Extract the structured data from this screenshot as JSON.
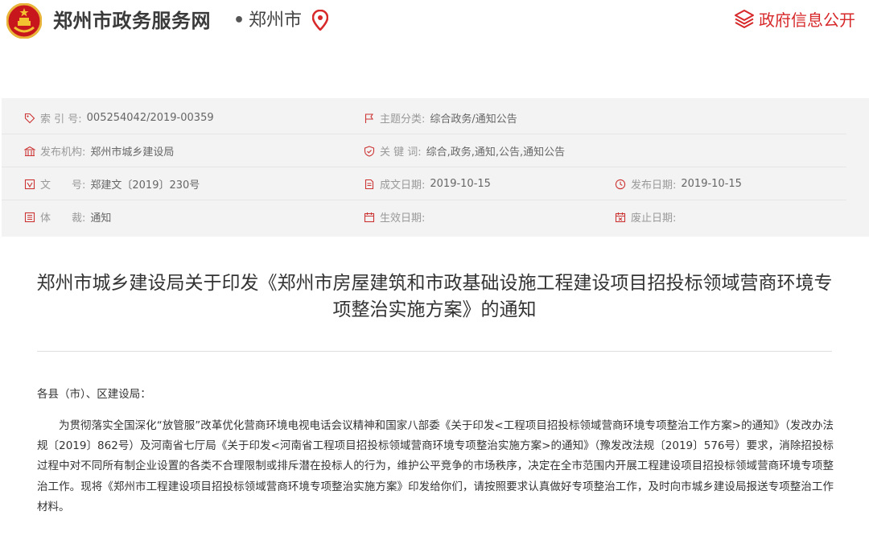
{
  "header": {
    "site_name": "郑州市政务服务网",
    "dot": "•",
    "city": "郑州市",
    "right_link": "政府信息公开",
    "accent_color": "#d7282a",
    "icons": [
      "national-emblem-icon",
      "location-pin-icon",
      "layers-icon"
    ]
  },
  "info": {
    "index_label": "索 引 号:",
    "index_value": "005254042/2019-00359",
    "category_label": "主题分类:",
    "category_value": "综合政务/通知公告",
    "issuer_label": "发布机构:",
    "issuer_value": "郑州市城乡建设局",
    "keywords_label": "关 键 词:",
    "keywords_value": "综合,政务,通知,公告,通知公告",
    "docno_label": "文　　号:",
    "docno_value": "郑建文〔2019〕230号",
    "created_label": "成文日期:",
    "created_value": "2019-10-15",
    "published_label": "发布日期:",
    "published_value": "2019-10-15",
    "genre_label": "体　　裁:",
    "genre_value": "通知",
    "effective_label": "生效日期:",
    "effective_value": "",
    "expiry_label": "废止日期:",
    "expiry_value": ""
  },
  "article": {
    "title": "郑州市城乡建设局关于印发《郑州市房屋建筑和市政基础设施工程建设项目招投标领域营商环境专项整治实施方案》的通知",
    "addressee": "各县（市）、区建设局：",
    "paragraph": "为贯彻落实全国深化“放管服”改革优化营商环境电视电话会议精神和国家八部委《关于印发<工程项目招投标领域营商环境专项整治工作方案>的通知》（发改办法规〔2019〕862号）及河南省七厅局《关于印发<河南省工程项目招投标领域营商环境专项整治实施方案>的通知》（豫发改法规〔2019〕576号）要求，消除招投标过程中对不同所有制企业设置的各类不合理限制或排斥潜在投标人的行为，维护公平竞争的市场秩序，决定在全市范围内开展工程建设项目招投标领域营商环境专项整治工作。现将《郑州市工程建设项目招投标领域营商环境专项整治实施方案》印发给你们，请按照要求认真做好专项整治工作，及时向市城乡建设局报送专项整治工作材料。"
  }
}
